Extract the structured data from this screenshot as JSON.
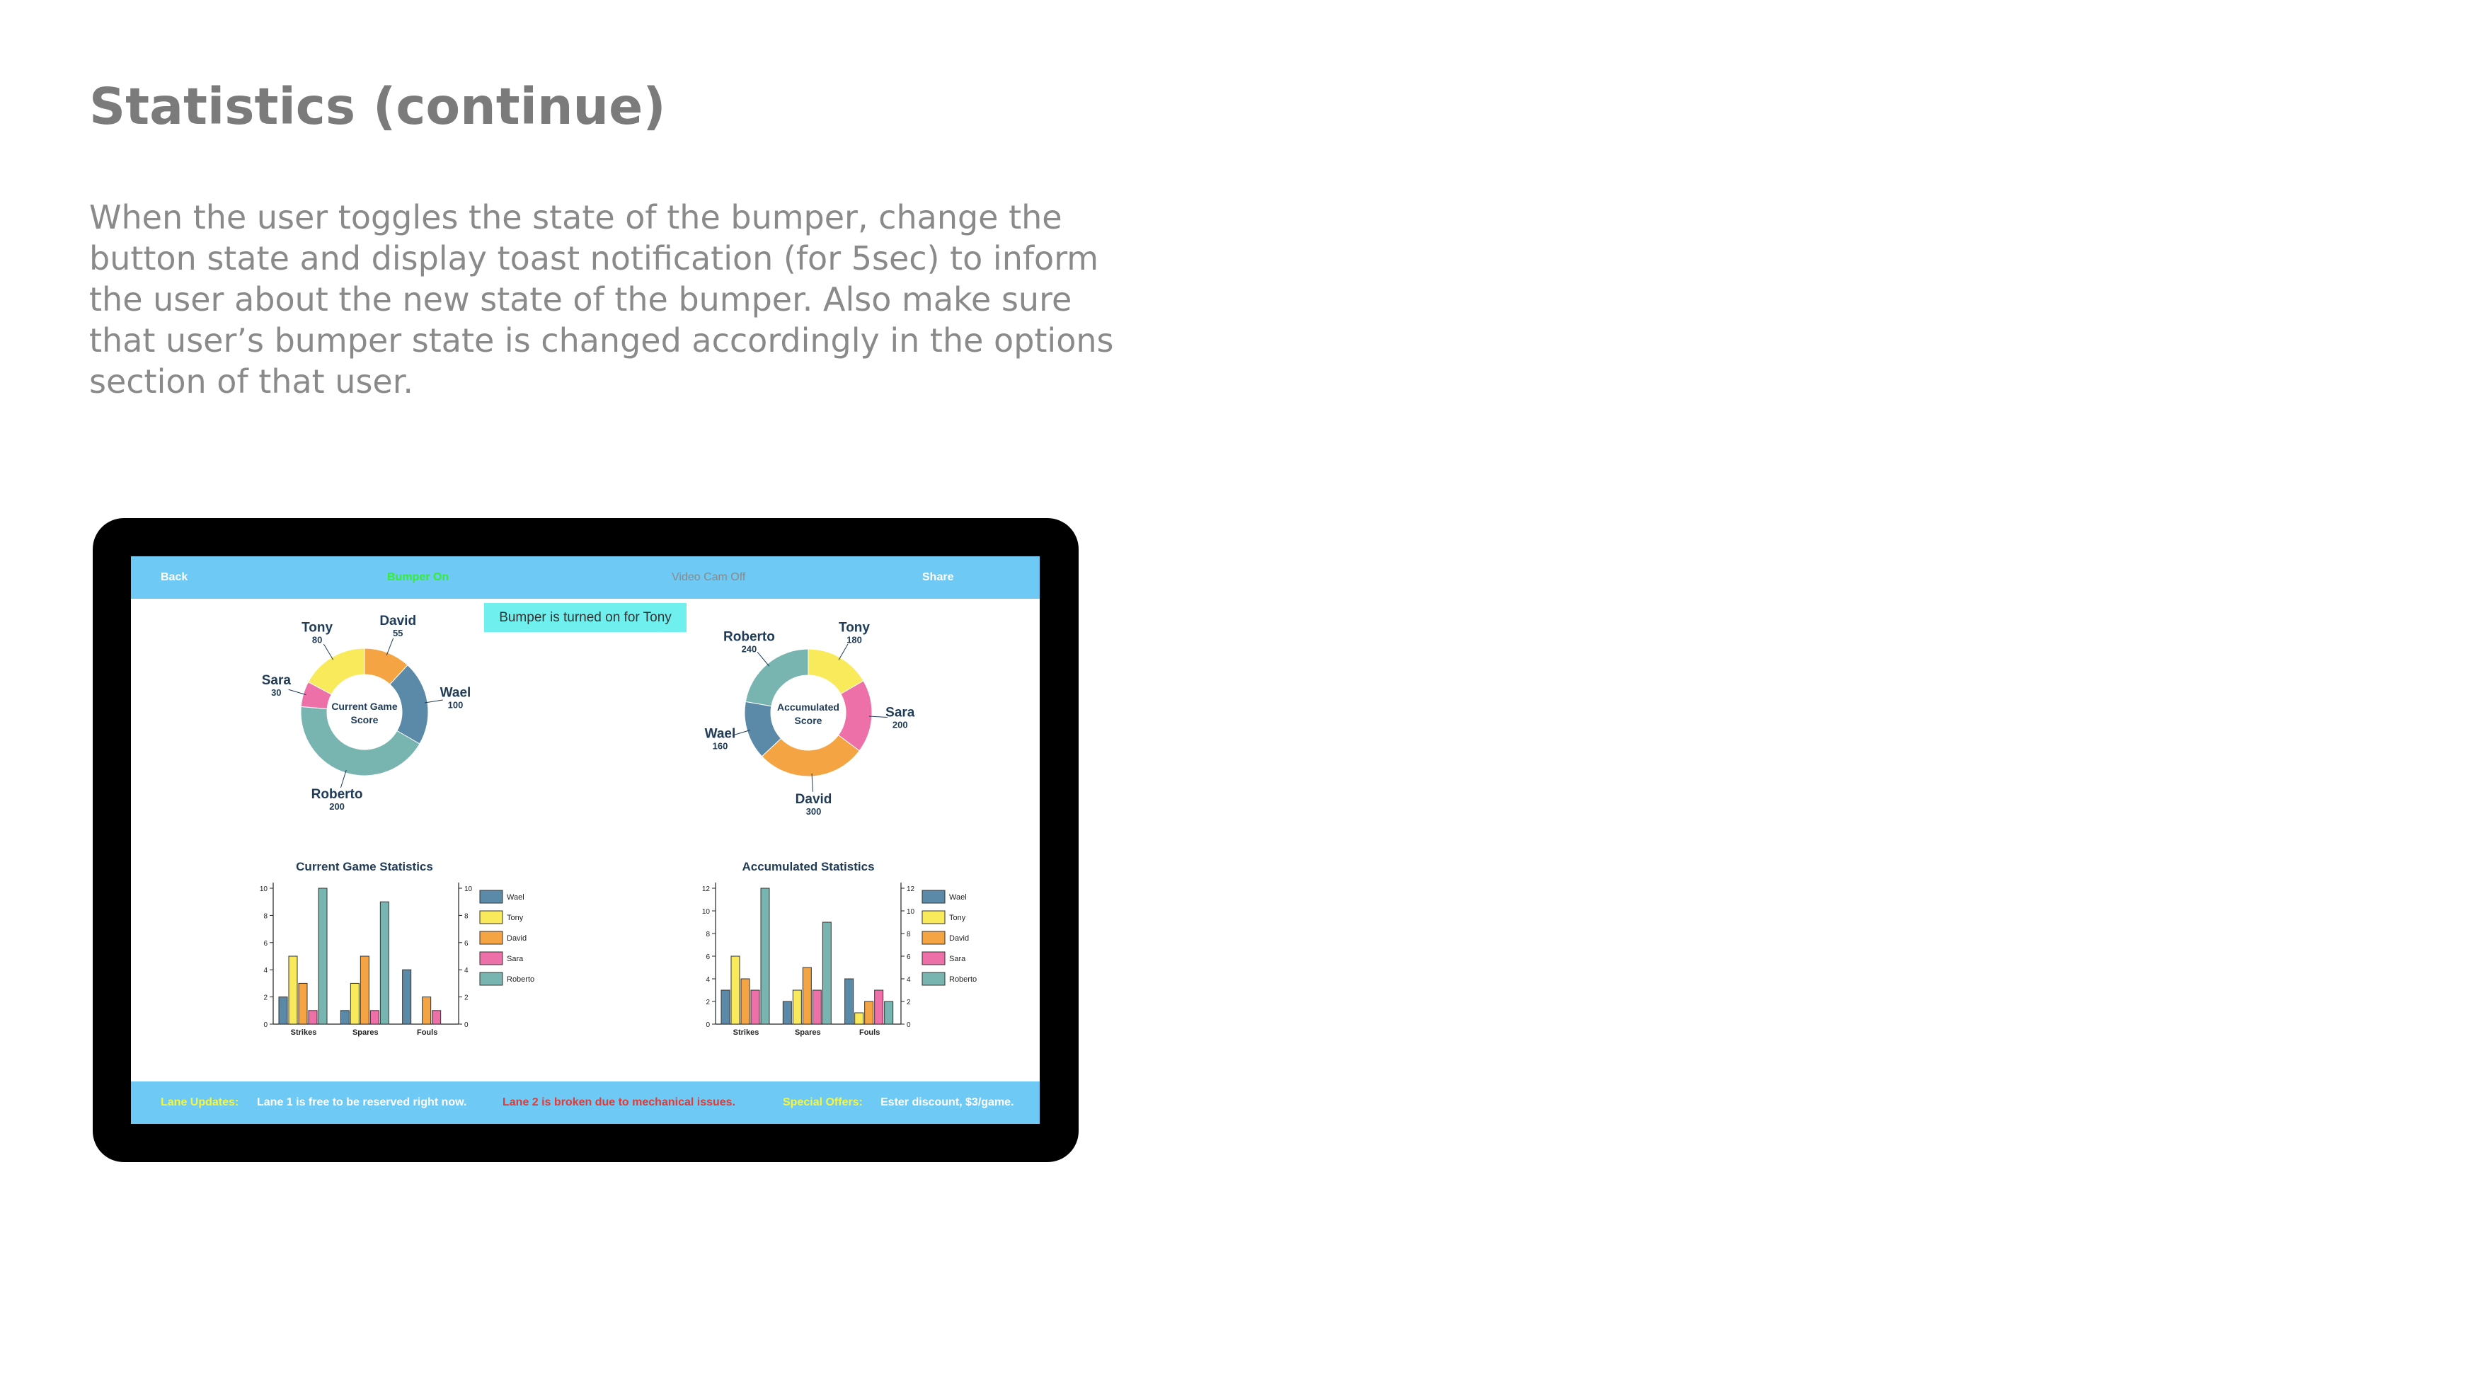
{
  "slide": {
    "title": "Statistics (continue)",
    "description": "When the user toggles the state of the bumper, change the button state and display toast notification (for 5sec) to inform the user about the new state of the bumper. Also make sure that user’s bumper state is changed accordingly in the options section of that user."
  },
  "app": {
    "topbar": {
      "back": "Back",
      "bumper": "Bumper On",
      "video_cam": "Video Cam Off",
      "share": "Share"
    },
    "toast": "Bumper is turned on for Tony",
    "bottombar": {
      "lane_updates_label": "Lane Updates:",
      "lane1_message": "Lane 1 is free to be reserved right now.",
      "lane2_message": "Lane 2 is broken due to mechanical issues.",
      "special_offers_label": "Special Offers:",
      "special_offers_text": "Ester  discount, $3/game."
    },
    "colors": {
      "bar": "#6ec9f5",
      "bumper_on": "#33ee33",
      "video_off": "#8a8a8a",
      "lane2_alert": "#e53935",
      "label_highlight": "#f6f63a",
      "Wael": "#5a8aa8",
      "Tony": "#f8ea5a",
      "David": "#f4a443",
      "Sara": "#ee70a8",
      "Roberto": "#79b5b0"
    }
  },
  "chart_data": [
    {
      "type": "pie",
      "title": "Current Game Score",
      "slices": [
        {
          "name": "David",
          "value": 55
        },
        {
          "name": "Wael",
          "value": 100
        },
        {
          "name": "Roberto",
          "value": 200
        },
        {
          "name": "Sara",
          "value": 30
        },
        {
          "name": "Tony",
          "value": 80
        }
      ]
    },
    {
      "type": "pie",
      "title": "Accumulated Score",
      "slices": [
        {
          "name": "Tony",
          "value": 180
        },
        {
          "name": "Sara",
          "value": 200
        },
        {
          "name": "David",
          "value": 300
        },
        {
          "name": "Wael",
          "value": 160
        },
        {
          "name": "Roberto",
          "value": 240
        }
      ]
    },
    {
      "type": "bar",
      "title": "Current Game Statistics",
      "categories": [
        "Strikes",
        "Spares",
        "Fouls"
      ],
      "ylim": [
        0,
        10
      ],
      "yticks": [
        0,
        2,
        4,
        6,
        8,
        10
      ],
      "legend": "right",
      "series": [
        {
          "name": "Wael",
          "values": [
            2,
            1,
            4
          ]
        },
        {
          "name": "Tony",
          "values": [
            5,
            3,
            0
          ]
        },
        {
          "name": "David",
          "values": [
            3,
            5,
            2
          ]
        },
        {
          "name": "Sara",
          "values": [
            1,
            1,
            1
          ]
        },
        {
          "name": "Roberto",
          "values": [
            10,
            9,
            0
          ]
        }
      ]
    },
    {
      "type": "bar",
      "title": "Accumulated Statistics",
      "categories": [
        "Strikes",
        "Spares",
        "Fouls"
      ],
      "ylim": [
        0,
        12
      ],
      "yticks": [
        0,
        2,
        4,
        6,
        8,
        10,
        12
      ],
      "legend": "right",
      "series": [
        {
          "name": "Wael",
          "values": [
            3,
            2,
            4
          ]
        },
        {
          "name": "Tony",
          "values": [
            6,
            3,
            1
          ]
        },
        {
          "name": "David",
          "values": [
            4,
            5,
            2
          ]
        },
        {
          "name": "Sara",
          "values": [
            3,
            3,
            3
          ]
        },
        {
          "name": "Roberto",
          "values": [
            12,
            9,
            2
          ]
        }
      ]
    }
  ]
}
